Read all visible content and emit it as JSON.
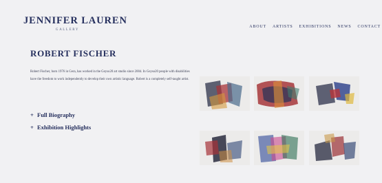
{
  "brand": {
    "name": "JENNIFER LAUREN",
    "sub": "GALLERY"
  },
  "nav": [
    "ABOUT",
    "ARTISTS",
    "EXHIBITIONS",
    "NEWS",
    "CONTACT"
  ],
  "artist": {
    "name": "ROBERT FISCHER",
    "bio": "Robert Fischer, born 1976 in Gera, has worked in the Geyso20 art studio since 2004. In Geyso20 people with disabilities have the freedom to work independently to develop their own artistic language. Robert is a completely self-taught artist."
  },
  "sections": [
    {
      "icon": "plus",
      "label": "Full Biography"
    },
    {
      "icon": "plus",
      "label": "Exhibition Highlights"
    }
  ],
  "colors": {
    "accent": "#26305e",
    "background": "#f1f1f3"
  }
}
